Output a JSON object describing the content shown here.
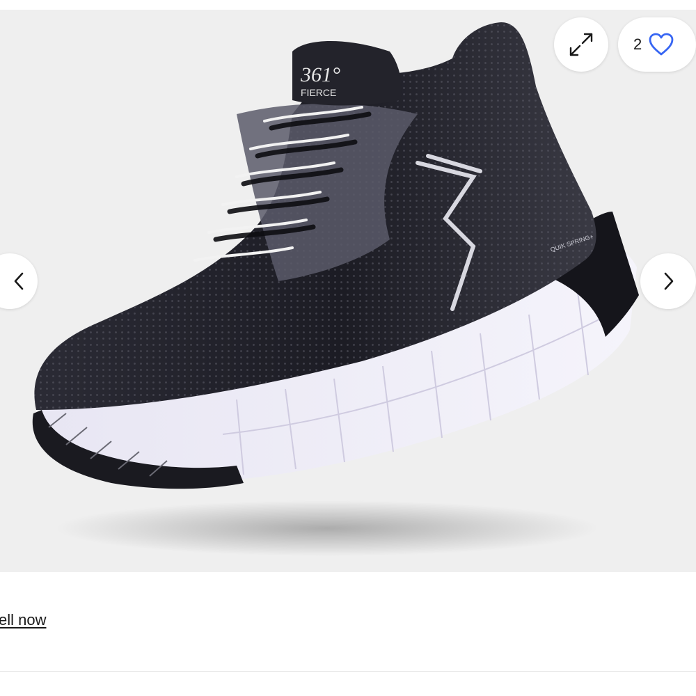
{
  "gallery": {
    "watch_count": "2",
    "expand_icon": "expand-arrows-icon",
    "heart_icon": "heart-outline-icon",
    "prev_icon": "chevron-left-icon",
    "next_icon": "chevron-right-icon",
    "image_logo_text": "361°",
    "image_model_text": "FIERCE",
    "image_sole_text": "QUIK SPRING+",
    "accent_color": "#3665f3"
  },
  "footer": {
    "sell_label": "ell now"
  }
}
